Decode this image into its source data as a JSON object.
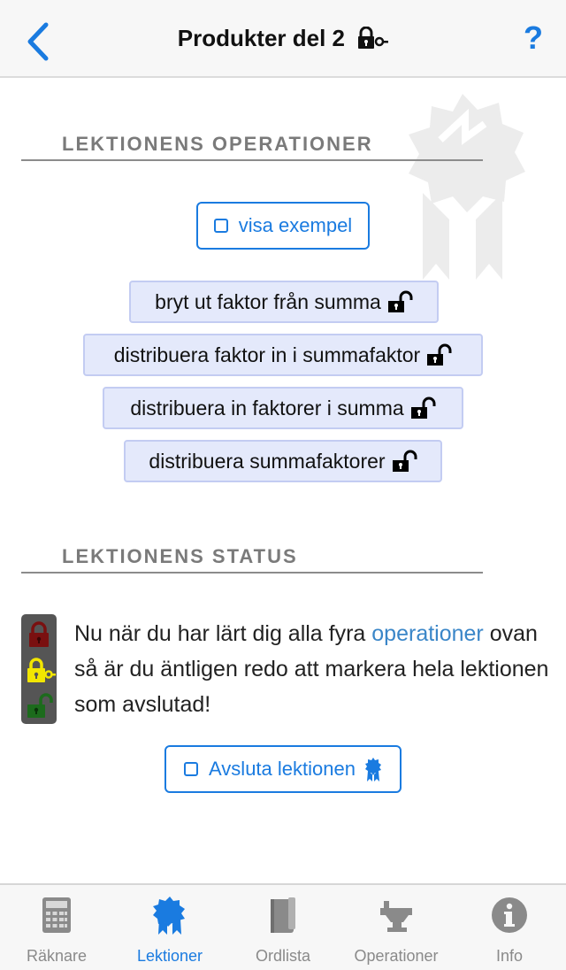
{
  "header": {
    "title": "Produkter del 2",
    "help_label": "?"
  },
  "sections": {
    "operations_title": "LEKTIONENS OPERATIONER",
    "status_title": "LEKTIONENS STATUS"
  },
  "example_button": {
    "label": "visa exempel"
  },
  "operations": [
    {
      "label": "bryt ut faktor från summa"
    },
    {
      "label": "distribuera faktor in i summafaktor"
    },
    {
      "label": "distribuera in faktorer i summa"
    },
    {
      "label": "distribuera summafaktorer"
    }
  ],
  "status": {
    "text_before": "Nu när du har lärt dig alla fyra ",
    "link": "operationer",
    "text_after": " ovan så är du äntligen redo att markera hela lektionen som avslutad!"
  },
  "finish_button": {
    "label": "Avsluta lektionen"
  },
  "tabs": [
    {
      "label": "Räknare",
      "icon": "calculator-icon",
      "active": false
    },
    {
      "label": "Lektioner",
      "icon": "badge-icon",
      "active": true
    },
    {
      "label": "Ordlista",
      "icon": "book-icon",
      "active": false
    },
    {
      "label": "Operationer",
      "icon": "anvil-icon",
      "active": false
    },
    {
      "label": "Info",
      "icon": "info-icon",
      "active": false
    }
  ],
  "colors": {
    "accent": "#1a7be0",
    "chip_bg": "#e4e9fb",
    "traffic_red": "#7a1010",
    "traffic_yellow": "#f2e600",
    "traffic_green": "#1c6b1c"
  }
}
